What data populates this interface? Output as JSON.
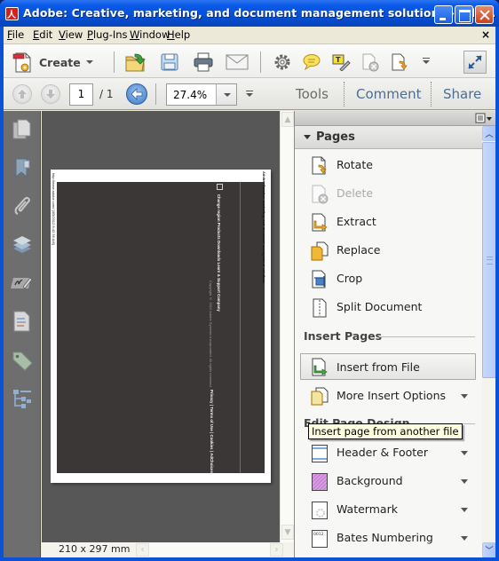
{
  "window": {
    "title": "Adobe: Creative, marketing, and document management solutions - Ado...",
    "controls": [
      "minimize",
      "maximize",
      "close"
    ]
  },
  "menubar": {
    "items": [
      {
        "label": "File",
        "mnemonic": "F",
        "rest": "ile"
      },
      {
        "label": "Edit",
        "mnemonic": "E",
        "rest": "dit"
      },
      {
        "label": "View",
        "mnemonic": "V",
        "rest": "iew"
      },
      {
        "label": "Plug-Ins",
        "mnemonic": "P",
        "rest": "lug-Ins"
      },
      {
        "label": "Window",
        "mnemonic": "W",
        "rest": "indow"
      },
      {
        "label": "Help",
        "mnemonic": "H",
        "rest": "elp"
      }
    ],
    "close_glyph": "×"
  },
  "toolbar": {
    "create_label": "Create",
    "icons": [
      "open-icon",
      "save-icon",
      "print-icon",
      "email-icon",
      "settings-icon",
      "comment-icon",
      "typewriter-icon",
      "delete-page-icon",
      "rotate-page-icon",
      "more-tools-icon",
      "fullscreen-icon"
    ]
  },
  "navbar": {
    "page_current": "1",
    "page_total": "/ 1",
    "zoom_value": "27.4%",
    "tabs": [
      {
        "label": "Tools",
        "active": true
      },
      {
        "label": "Comment",
        "active": false
      },
      {
        "label": "Share",
        "active": false
      }
    ]
  },
  "nav_rail": {
    "icons": [
      "page-thumbnails-icon",
      "bookmarks-icon",
      "attachments-icon",
      "layers-icon",
      "signatures-icon",
      "content-icon",
      "tags-icon",
      "model-tree-icon"
    ]
  },
  "document": {
    "page_size": "210 x 297 mm",
    "page_text": {
      "title_line": "Adobe: Creative, marketing, and document management solutions",
      "url_line": "http://www.adobe.com/ [4/5/2012 8:42:36 AM]",
      "nav_links": "Change region   Products   Downloads   Learn & Support   Company",
      "copyright": "Copyright © 2012 Adobe Systems Incorporated. All rights reserved.",
      "footer_links": "Privacy | Terms of Use | Cookies | AdChoices"
    }
  },
  "tools_pane": {
    "section_title": "Pages",
    "page_tools": [
      {
        "label": "Rotate",
        "icon": "rotate-icon",
        "disabled": false
      },
      {
        "label": "Delete",
        "icon": "delete-icon",
        "disabled": true
      },
      {
        "label": "Extract",
        "icon": "extract-icon",
        "disabled": false
      },
      {
        "label": "Replace",
        "icon": "replace-icon",
        "disabled": false
      },
      {
        "label": "Crop",
        "icon": "crop-icon",
        "disabled": false
      },
      {
        "label": "Split Document",
        "icon": "split-document-icon",
        "disabled": false
      }
    ],
    "insert_group_label": "Insert Pages",
    "insert_tools": [
      {
        "label": "Insert from File",
        "icon": "insert-file-icon",
        "has_dropdown": false
      },
      {
        "label": "More Insert Options",
        "icon": "more-insert-icon",
        "has_dropdown": true
      }
    ],
    "design_group_label": "Edit Page Design",
    "design_tools": [
      {
        "label": "Header & Footer",
        "icon": "header-footer-icon",
        "has_dropdown": true
      },
      {
        "label": "Background",
        "icon": "background-icon",
        "has_dropdown": true
      },
      {
        "label": "Watermark",
        "icon": "watermark-icon",
        "has_dropdown": true
      },
      {
        "label": "Bates Numbering",
        "icon": "bates-numbering-icon",
        "has_dropdown": true
      }
    ],
    "tooltip": "Insert page from another file",
    "bates_glyph": "0012"
  }
}
